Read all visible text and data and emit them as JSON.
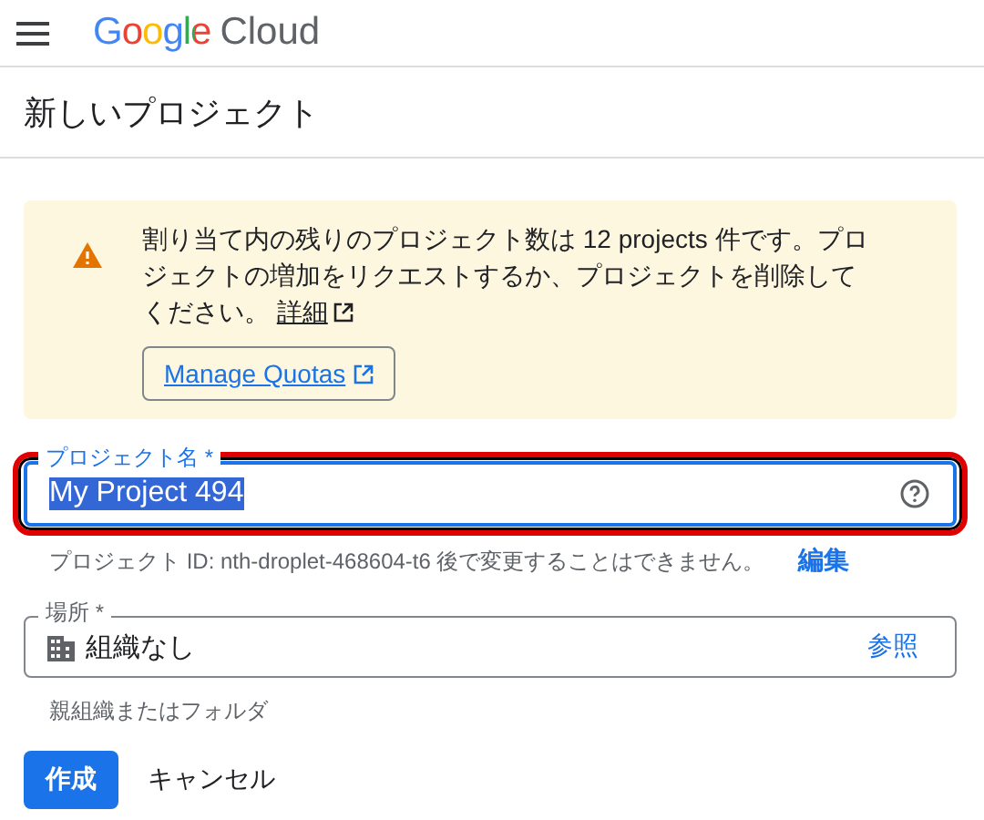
{
  "header": {
    "logo_google": "Google",
    "logo_cloud": "Cloud"
  },
  "page_title": "新しいプロジェクト",
  "alert": {
    "kind": "warning",
    "message": "割り当て内の残りのプロジェクト数は 12 projects 件です。プロジェクトの増加をリクエストするか、プロジェクトを削除してください。",
    "link": "詳細",
    "button": "Manage Quotas"
  },
  "fields": [
    {
      "kind": "text",
      "label": "プロジェクト名 *",
      "value": "My Project 494",
      "focused": true,
      "text_selected": true,
      "highlighted": true,
      "hint": "プロジェクト ID: nth-droplet-468604-t6 後で変更することはできません。",
      "hint_action": "編集"
    },
    {
      "kind": "picker",
      "label": "場所 *",
      "value": "組織なし",
      "focused": false,
      "highlighted": false,
      "action": "参照",
      "hint": "親組織またはフォルダ"
    }
  ],
  "buttons": [
    {
      "label": "作成",
      "kind": "primary"
    },
    {
      "label": "キャンセル",
      "kind": "text"
    }
  ]
}
